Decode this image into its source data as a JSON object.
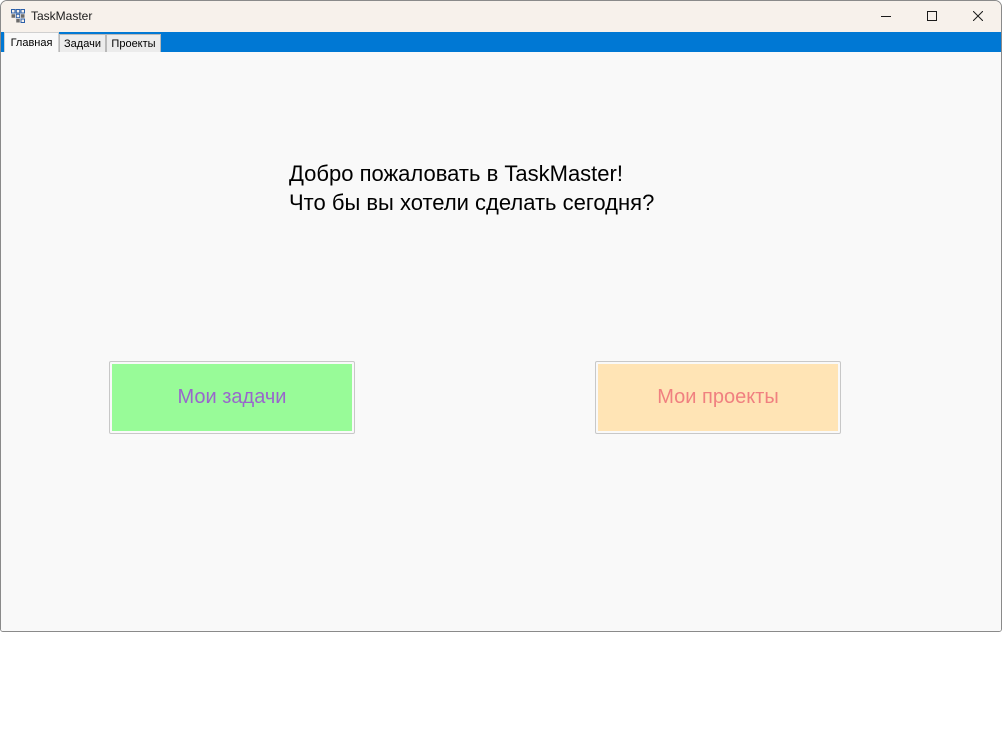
{
  "window": {
    "title": "TaskMaster",
    "app_icon": "app-grid-icon",
    "controls": {
      "minimize_icon": "minimize-icon",
      "maximize_icon": "maximize-icon",
      "close_icon": "close-icon"
    }
  },
  "tabs": [
    {
      "label": "Главная",
      "active": true
    },
    {
      "label": "Задачи",
      "active": false
    },
    {
      "label": "Проекты",
      "active": false
    }
  ],
  "main": {
    "welcome_line1": "Добро пожаловать в TaskMaster!",
    "welcome_line2": "Что бы вы хотели сделать сегодня?",
    "tasks_button": {
      "label": "Мои задачи",
      "background": "#98fb98",
      "text_color": "#9966cc"
    },
    "projects_button": {
      "label": "Мои проекты",
      "background": "#ffe4b5",
      "text_color": "#f08080"
    }
  },
  "colors": {
    "tabstrip_accent": "#0078d4",
    "titlebar": "#f7f1eb",
    "content_background": "#f9f9f9"
  }
}
